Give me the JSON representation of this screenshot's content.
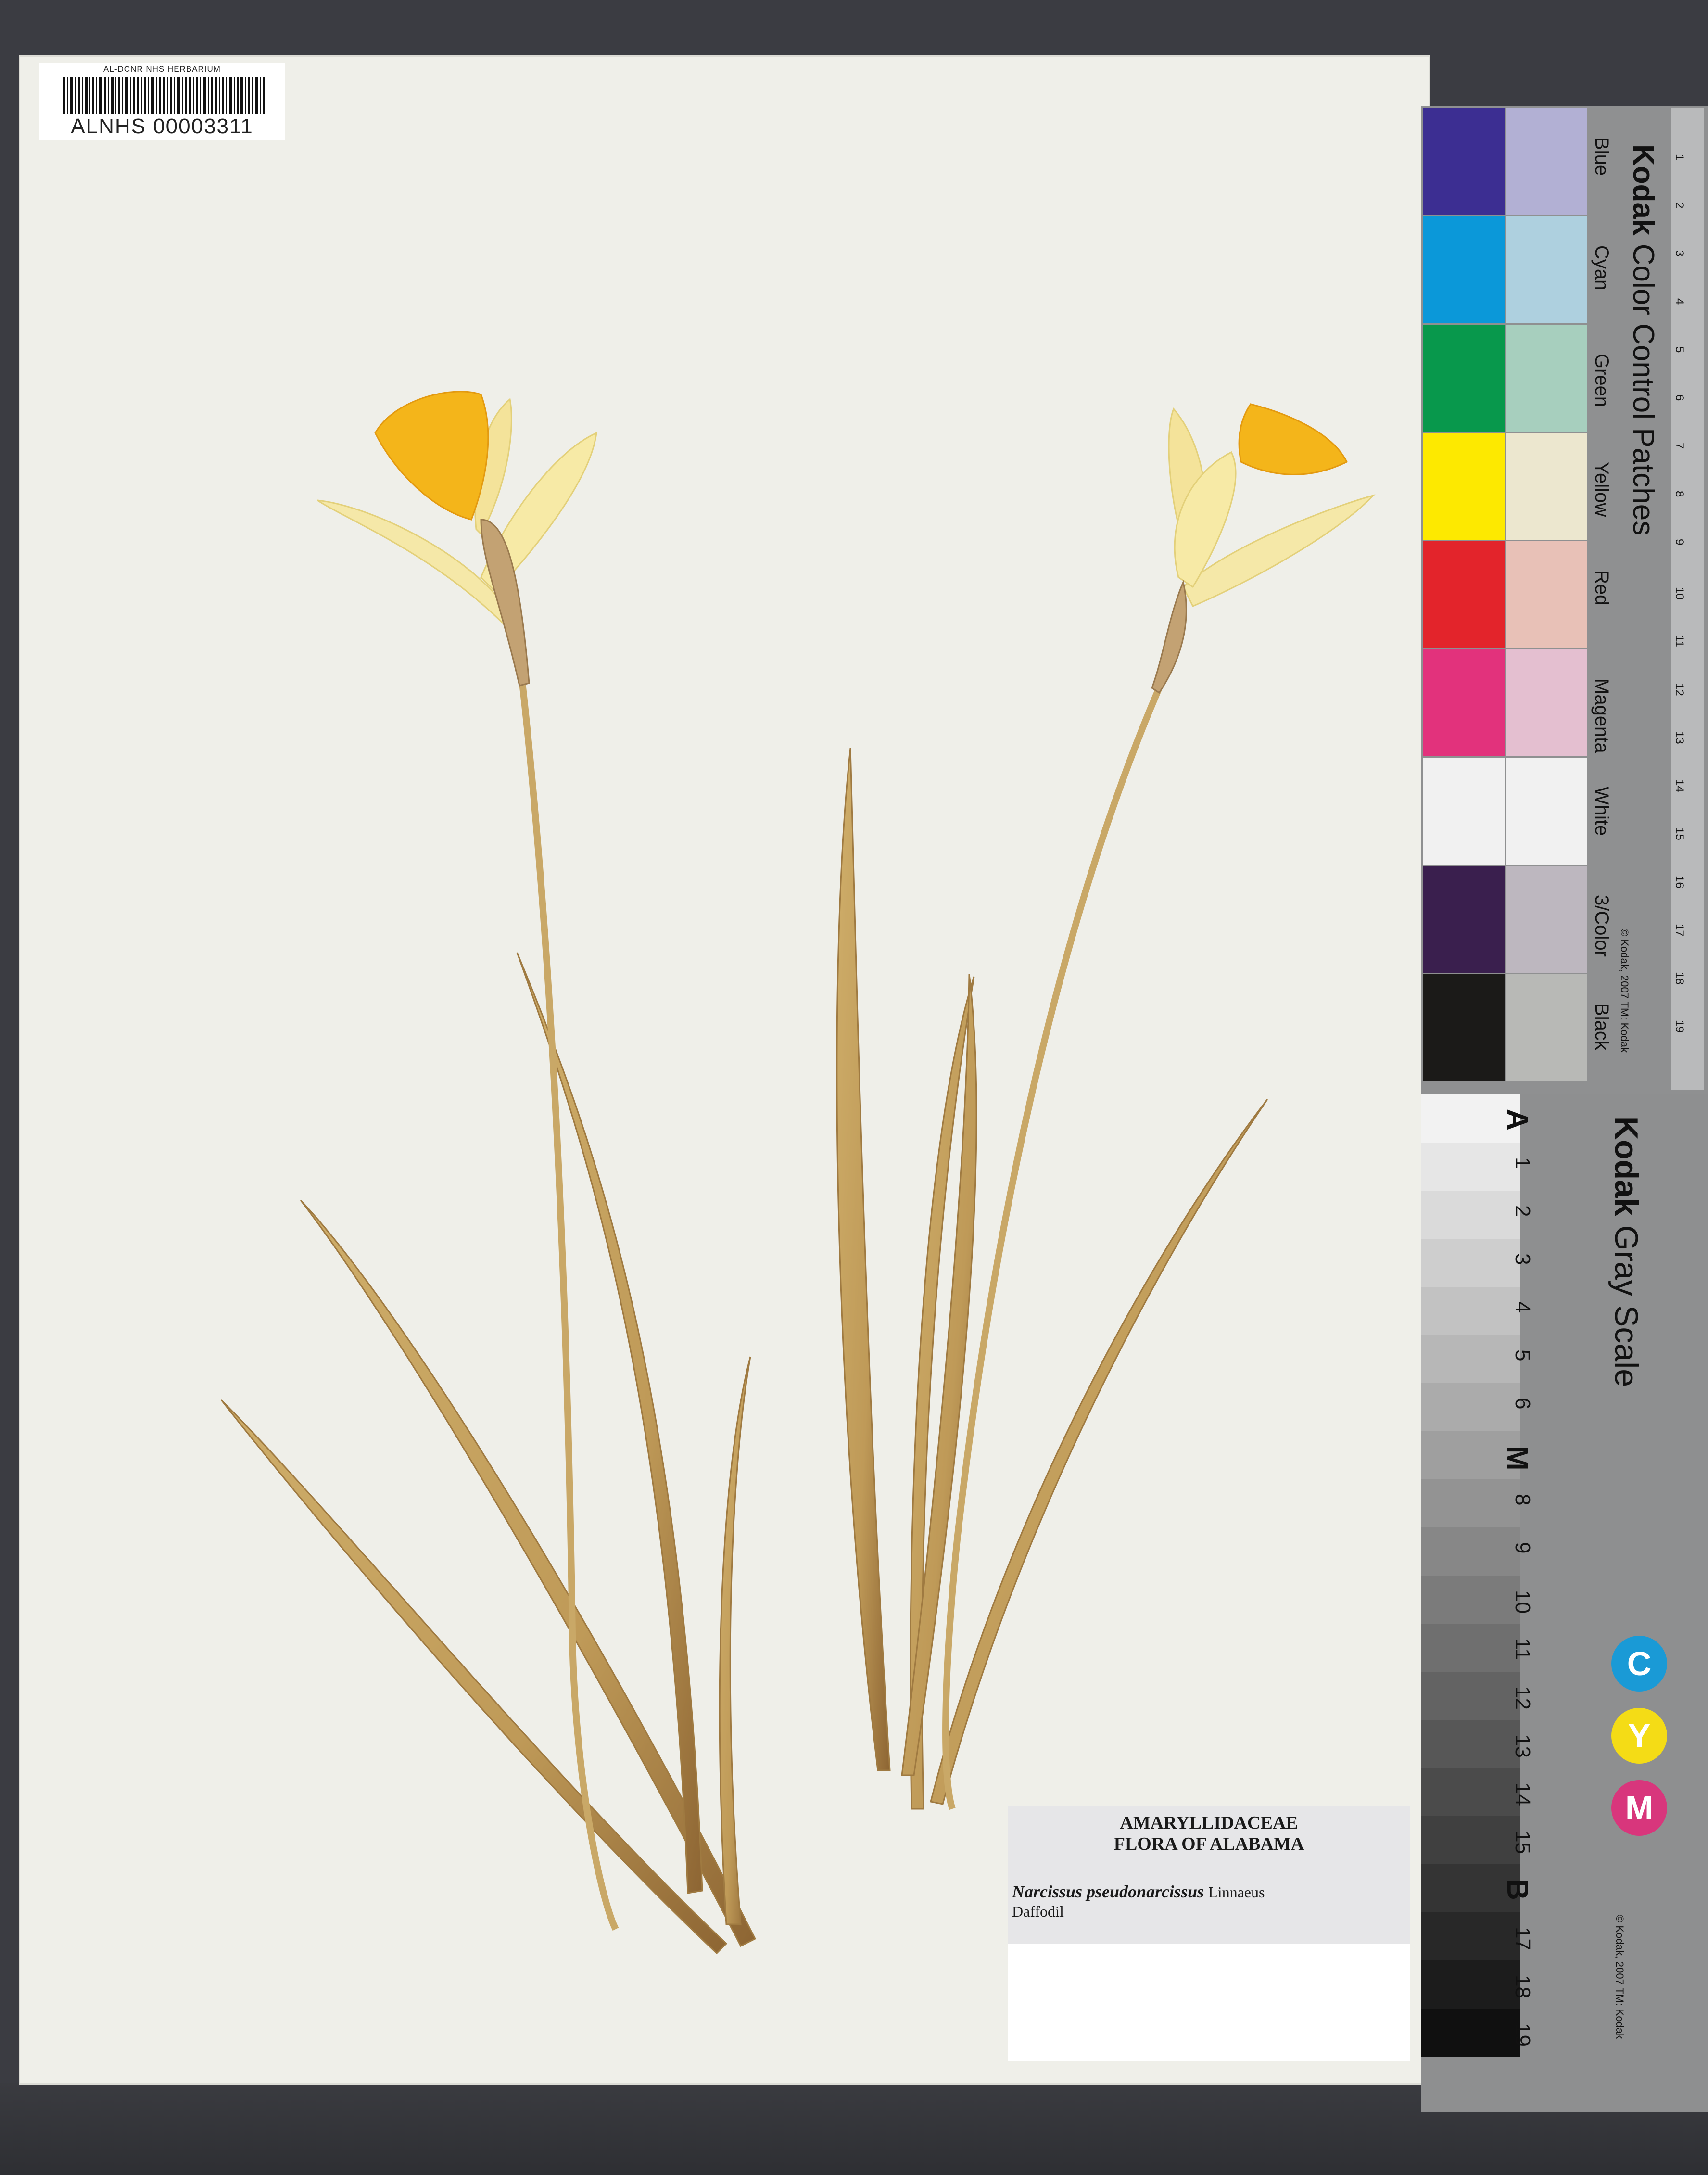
{
  "barcode_label": {
    "herbarium": "AL-DCNR NHS HERBARIUM",
    "catalog_number": "ALNHS 00003311"
  },
  "determination_label": {
    "family": "AMARYLLIDACEAE",
    "flora": "FLORA OF ALABAMA",
    "species": "Narcissus pseudonarcissus",
    "author": "Linnaeus",
    "common_name": "Daffodil"
  },
  "color_chart": {
    "brand": "Kodak",
    "title": "Color Control Patches",
    "copyright": "© Kodak, 2007 TM: Kodak",
    "ruler_units_top": "inches",
    "ruler_units_bottom": "cm",
    "patches": [
      {
        "label": "Blue",
        "dark": "#3c2e92",
        "light": "#b2b0d4"
      },
      {
        "label": "Cyan",
        "dark": "#0b98d9",
        "light": "#aed0df"
      },
      {
        "label": "Green",
        "dark": "#08984c",
        "light": "#a7cfbe"
      },
      {
        "label": "Yellow",
        "dark": "#fde900",
        "light": "#ece7cf"
      },
      {
        "label": "Red",
        "dark": "#e3242b",
        "light": "#e8c1b7"
      },
      {
        "label": "Magenta",
        "dark": "#e2327c",
        "light": "#e4bfd0"
      },
      {
        "label": "White",
        "dark": "#f1f1f1",
        "light": "#f1f1f1"
      },
      {
        "label": "3/Color",
        "dark": "#3a1f4e",
        "light": "#bdb7bf"
      },
      {
        "label": "Black",
        "dark": "#1b1a18",
        "light": "#b8b9b6"
      }
    ],
    "ruler_cm": [
      "1",
      "2",
      "3",
      "4",
      "5",
      "6",
      "7",
      "8",
      "9",
      "10",
      "11",
      "12",
      "13",
      "14",
      "15",
      "16",
      "17",
      "18",
      "19"
    ]
  },
  "gray_scale": {
    "brand": "Kodak",
    "title": "Gray Scale",
    "copyright": "© Kodak, 2007 TM: Kodak",
    "steps": [
      "A",
      "1",
      "2",
      "3",
      "4",
      "5",
      "6",
      "M",
      "8",
      "9",
      "10",
      "11",
      "12",
      "13",
      "14",
      "15",
      "B",
      "17",
      "18",
      "19"
    ],
    "cym": [
      {
        "letter": "C",
        "color": "#1a9ad6"
      },
      {
        "letter": "Y",
        "color": "#f4dc16"
      },
      {
        "letter": "M",
        "color": "#d8367c"
      }
    ]
  }
}
